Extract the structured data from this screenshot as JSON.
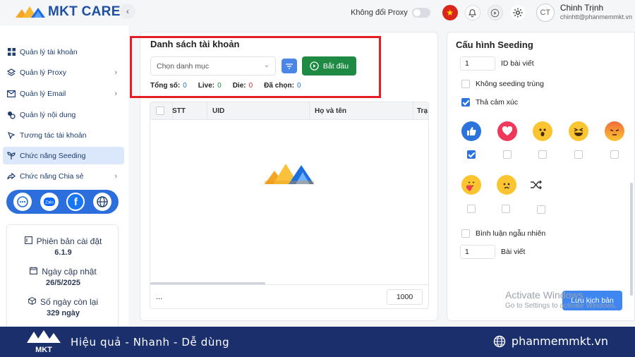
{
  "app": {
    "logo_text": "MKT CARE"
  },
  "topbar": {
    "proxy_label": "Không đổi Proxy",
    "avatar_initials": "CT",
    "user_name": "Chinh Trịnh",
    "user_email": "chinhtt@phanmemmkt.vn"
  },
  "sidebar": {
    "items": [
      {
        "label": "Quản lý tài khoản",
        "icon": "grid-icon"
      },
      {
        "label": "Quản lý Proxy",
        "icon": "layers-icon",
        "chevron": true
      },
      {
        "label": "Quản lý Email",
        "icon": "mail-icon",
        "chevron": true
      },
      {
        "label": "Quản lý nội dung",
        "icon": "content-icon"
      },
      {
        "label": "Tương tác tài khoản",
        "icon": "interact-icon"
      },
      {
        "label": "Chức năng Seeding",
        "icon": "seeding-icon",
        "active": true
      },
      {
        "label": "Chức năng Chia sẻ",
        "icon": "share-icon",
        "chevron": true
      }
    ],
    "social": [
      "support-icon",
      "zalo-icon",
      "facebook-icon",
      "globe-icon"
    ],
    "info": {
      "version_label": "Phiên bản cài đặt",
      "version": "6.1.9",
      "updated_label": "Ngày cập nhật",
      "updated": "26/5/2025",
      "remaining_label": "Số ngày còn lại",
      "remaining": "329 ngày"
    }
  },
  "accounts": {
    "title": "Danh sách tài khoản",
    "category_placeholder": "Chọn danh mục",
    "start_label": "Bắt đầu",
    "stats": {
      "total_label": "Tổng số:",
      "total": "0",
      "live_label": "Live:",
      "live": "0",
      "die_label": "Die:",
      "die": "0",
      "selected_label": "Đã chọn:",
      "selected": "0"
    },
    "columns": [
      "STT",
      "UID",
      "Họ và tên",
      "Trạ"
    ],
    "footer_text": "...",
    "page_size": "1000"
  },
  "seeding": {
    "title": "Cấu hình Seeding",
    "post_id_count": "1",
    "post_id_label": "ID bài viết",
    "no_duplicate_label": "Không seeding trùng",
    "reaction_label": "Thả cảm xúc",
    "reactions": [
      {
        "name": "like",
        "checked": true
      },
      {
        "name": "love",
        "checked": false
      },
      {
        "name": "wow",
        "checked": false
      },
      {
        "name": "haha",
        "checked": false
      },
      {
        "name": "angry",
        "checked": false
      },
      {
        "name": "care",
        "checked": false
      },
      {
        "name": "sad",
        "checked": false
      },
      {
        "name": "random",
        "checked": false
      }
    ],
    "random_comment_label": "Bình luận ngẫu nhiên",
    "post_count": "1",
    "post_count_label": "Bài viết",
    "save_label": "Lưu kịch bản"
  },
  "watermark": {
    "line1": "Activate Windows",
    "line2": "Go to Settings to activate Windows."
  },
  "banner": {
    "slogan": "Hiệu quả - Nhanh - Dễ dùng",
    "site": "phanmemmkt.vn"
  },
  "colors": {
    "primary": "#2c6fdc",
    "start": "#1f8a44",
    "banner": "#1a2f6b",
    "highlight": "#e31e24"
  }
}
